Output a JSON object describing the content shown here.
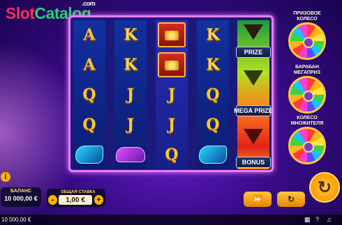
{
  "logo": {
    "slot": "Slot",
    "catalog": "Catalog",
    "com": ".com"
  },
  "reels": [
    [
      "A",
      "A",
      "Q",
      "Q",
      "jetski"
    ],
    [
      "K",
      "K",
      "J",
      "J",
      "car"
    ],
    [
      "chest",
      "chest",
      "J",
      "J",
      "Q"
    ],
    [
      "K",
      "K",
      "Q",
      "Q",
      "jetski"
    ]
  ],
  "bonus_reel": {
    "prize": "PRIZE",
    "mega_prize": "MEGA PRIZE",
    "bonus": "BONUS"
  },
  "wheels": [
    {
      "label_line1": "ПРИЗОВОЕ",
      "label_line2": "КОЛЕСО"
    },
    {
      "label_line1": "БАРАБАН",
      "label_line2": "МЕГАПРИЗ"
    },
    {
      "label_line1": "КОЛЕСО",
      "label_line2": "МНОЖИТЕЛЯ"
    }
  ],
  "controls": {
    "info": "i",
    "balance_label": "БАЛАНС",
    "balance_value": "10 000,00 €",
    "bet_label": "ОБЩАЯ СТАВКА",
    "bet_value": "1,00 €",
    "bet_minus": "-",
    "bet_plus": "+",
    "turbo_icon": "fast-forward-icon",
    "autoplay_icon": "autoplay-icon",
    "spin_icon": "spin-icon"
  },
  "status_bar": {
    "balance": "10 000,00 €"
  }
}
